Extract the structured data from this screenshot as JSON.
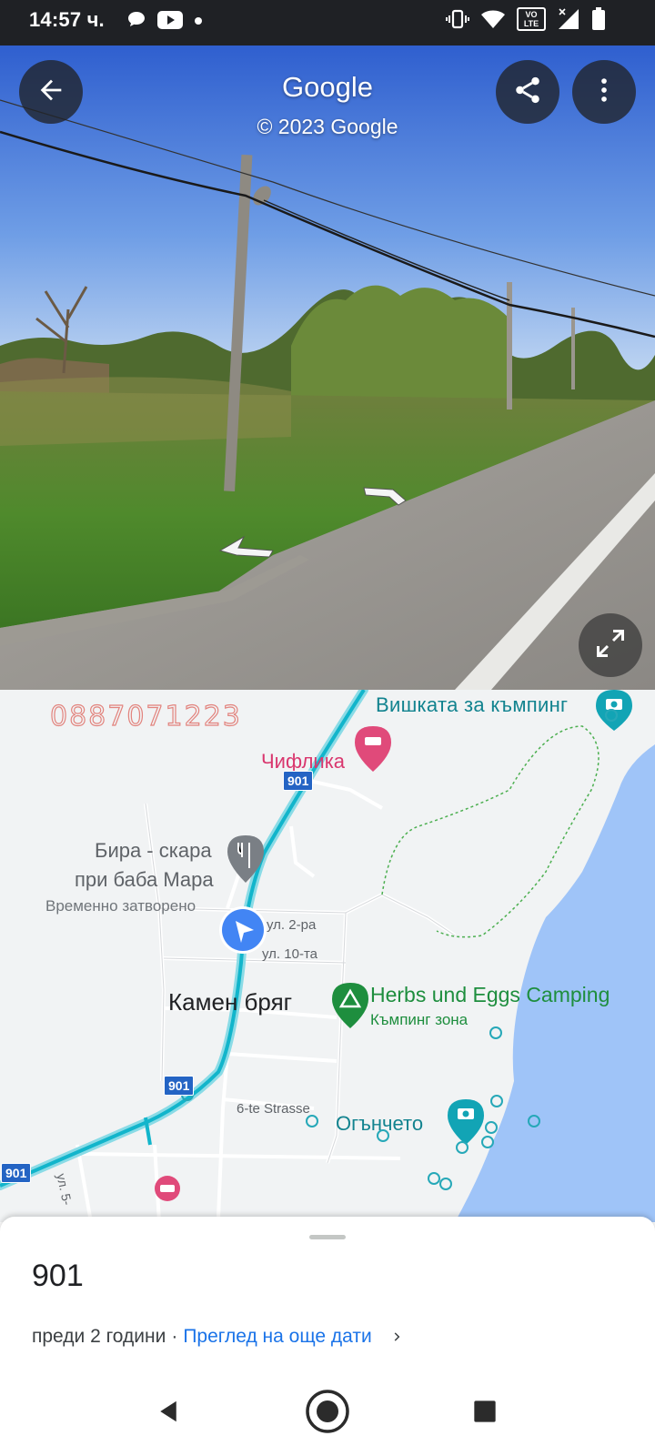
{
  "status_bar": {
    "time": "14:57 ч.",
    "icons": [
      "chat-bubble-icon",
      "youtube-icon",
      "dot-icon",
      "vibrate-icon",
      "wifi-icon",
      "volte-icon",
      "signal-icon",
      "battery-icon"
    ],
    "volte_text": "VO\nLTE"
  },
  "street_view": {
    "title": "Google",
    "copyright": "© 2023 Google",
    "buttons": [
      "back-arrow-icon",
      "share-icon",
      "more-vert-icon",
      "expand-icon"
    ]
  },
  "map": {
    "phone_overlay": "0887071223",
    "places": {
      "tower": "Вишката за къмпинг",
      "chiflika": "Чифлика",
      "bira_line1": "Бира - скара",
      "bira_line2": "при баба Мара",
      "bira_status": "Временно затворено",
      "village": "Камен бряг",
      "herbs": "Herbs und Eggs Camping",
      "herbs_sub": "Къмпинг зона",
      "ognche": "Огънчето"
    },
    "streets": {
      "s2": "ул. 2-ра",
      "s10": "ул. 10-та",
      "s6": "6-te Strasse",
      "s5": "ул. 5-"
    },
    "road_badges": [
      "901",
      "901",
      "901"
    ],
    "colors": {
      "land": "#f1f3f4",
      "sea": "#9fc4f8",
      "route": "#12b5cb",
      "road": "#ffffff",
      "marker": "#4285f4"
    }
  },
  "sheet": {
    "title": "901",
    "time_ago": "преди 2 години",
    "separator": "·",
    "more_dates": "Преглед на още дати"
  },
  "nav": {
    "back": "nav-back-icon",
    "home": "nav-home-icon",
    "recents": "nav-recents-icon"
  }
}
